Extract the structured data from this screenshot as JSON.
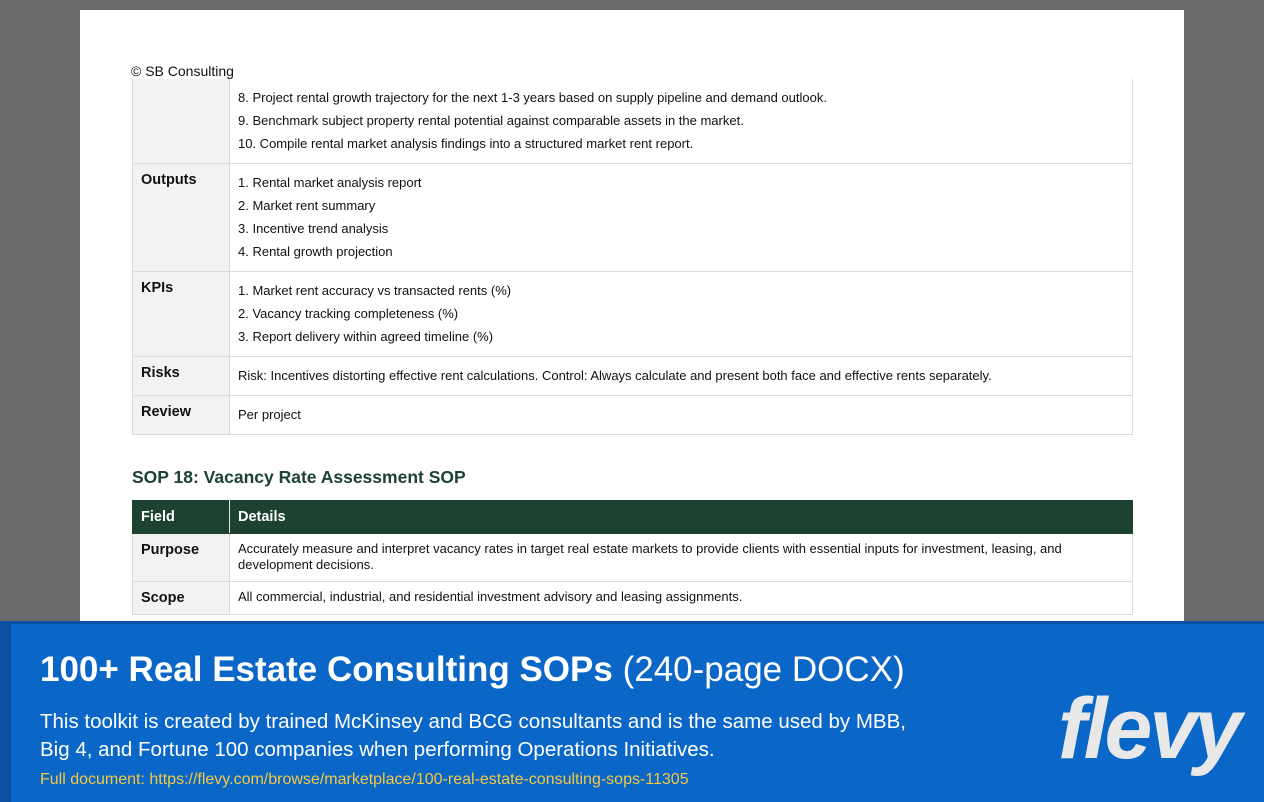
{
  "copyright": "© SB Consulting",
  "table1": {
    "continuation_lines": [
      "8. Project rental growth trajectory for the next 1-3 years based on supply pipeline and demand outlook.",
      "9. Benchmark subject property rental potential against comparable assets in the market.",
      "10. Compile rental market analysis findings into a structured market rent report."
    ],
    "rows": [
      {
        "field": "Outputs",
        "lines": [
          "1. Rental market analysis report",
          "2. Market rent summary",
          "3. Incentive trend analysis",
          "4. Rental growth projection"
        ]
      },
      {
        "field": "KPIs",
        "lines": [
          "1. Market rent accuracy vs transacted rents (%)",
          "2. Vacancy tracking completeness (%)",
          "3. Report delivery within agreed timeline (%)"
        ]
      },
      {
        "field": "Risks",
        "lines": [
          "Risk: Incentives distorting effective rent calculations. Control: Always calculate and present both face and effective rents separately."
        ]
      },
      {
        "field": "Review",
        "lines": [
          "Per project"
        ]
      }
    ]
  },
  "sop18": {
    "heading": "SOP 18: Vacancy Rate Assessment SOP",
    "header_field": "Field",
    "header_details": "Details",
    "rows": [
      {
        "field": "Purpose",
        "text": "Accurately measure and interpret vacancy rates in target real estate markets to provide clients with essential inputs for investment, leasing, and development decisions."
      },
      {
        "field": "Scope",
        "text": "All commercial, industrial, and residential investment advisory and leasing assignments."
      }
    ]
  },
  "banner": {
    "title_bold": "100+ Real Estate Consulting SOPs",
    "title_light": "(240-page DOCX)",
    "description": "This toolkit is created by trained McKinsey and BCG consultants and is the same used by MBB, Big 4, and Fortune 100 companies when performing Operations Initiatives.",
    "link": "Full document: https://flevy.com/browse/marketplace/100-real-estate-consulting-sops-11305",
    "logo": "flevy"
  }
}
